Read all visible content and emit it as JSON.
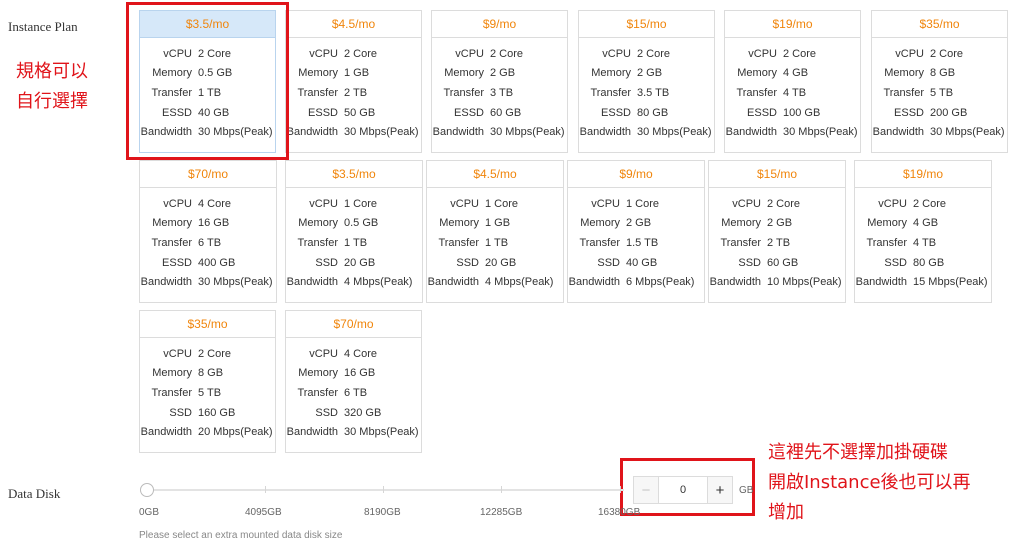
{
  "labels": {
    "instance_plan": "Instance Plan",
    "data_disk": "Data Disk"
  },
  "plans": [
    {
      "price": "$3.5/mo",
      "vcpu": "2 Core",
      "memory": "0.5 GB",
      "transfer": "1 TB",
      "disk_type": "ESSD",
      "disk": "40 GB",
      "bandwidth": "30 Mbps(Peak)",
      "selected": true
    },
    {
      "price": "$4.5/mo",
      "vcpu": "2 Core",
      "memory": "1 GB",
      "transfer": "2 TB",
      "disk_type": "ESSD",
      "disk": "50 GB",
      "bandwidth": "30 Mbps(Peak)"
    },
    {
      "price": "$9/mo",
      "vcpu": "2 Core",
      "memory": "2 GB",
      "transfer": "3 TB",
      "disk_type": "ESSD",
      "disk": "60 GB",
      "bandwidth": "30 Mbps(Peak)"
    },
    {
      "price": "$15/mo",
      "vcpu": "2 Core",
      "memory": "2 GB",
      "transfer": "3.5 TB",
      "disk_type": "ESSD",
      "disk": "80 GB",
      "bandwidth": "30 Mbps(Peak)"
    },
    {
      "price": "$19/mo",
      "vcpu": "2 Core",
      "memory": "4 GB",
      "transfer": "4 TB",
      "disk_type": "ESSD",
      "disk": "100 GB",
      "bandwidth": "30 Mbps(Peak)"
    },
    {
      "price": "$35/mo",
      "vcpu": "2 Core",
      "memory": "8 GB",
      "transfer": "5 TB",
      "disk_type": "ESSD",
      "disk": "200 GB",
      "bandwidth": "30 Mbps(Peak)"
    },
    {
      "price": "$70/mo",
      "vcpu": "4 Core",
      "memory": "16 GB",
      "transfer": "6 TB",
      "disk_type": "ESSD",
      "disk": "400 GB",
      "bandwidth": "30 Mbps(Peak)"
    },
    {
      "price": "$3.5/mo",
      "vcpu": "1 Core",
      "memory": "0.5 GB",
      "transfer": "1 TB",
      "disk_type": "SSD",
      "disk": "20 GB",
      "bandwidth": "4 Mbps(Peak)"
    },
    {
      "price": "$4.5/mo",
      "vcpu": "1 Core",
      "memory": "1 GB",
      "transfer": "1 TB",
      "disk_type": "SSD",
      "disk": "20 GB",
      "bandwidth": "4 Mbps(Peak)"
    },
    {
      "price": "$9/mo",
      "vcpu": "1 Core",
      "memory": "2 GB",
      "transfer": "1.5 TB",
      "disk_type": "SSD",
      "disk": "40 GB",
      "bandwidth": "6 Mbps(Peak)"
    },
    {
      "price": "$15/mo",
      "vcpu": "2 Core",
      "memory": "2 GB",
      "transfer": "2 TB",
      "disk_type": "SSD",
      "disk": "60 GB",
      "bandwidth": "10 Mbps(Peak)"
    },
    {
      "price": "$19/mo",
      "vcpu": "2 Core",
      "memory": "4 GB",
      "transfer": "4 TB",
      "disk_type": "SSD",
      "disk": "80 GB",
      "bandwidth": "15 Mbps(Peak)"
    },
    {
      "price": "$35/mo",
      "vcpu": "2 Core",
      "memory": "8 GB",
      "transfer": "5 TB",
      "disk_type": "SSD",
      "disk": "160 GB",
      "bandwidth": "20 Mbps(Peak)"
    },
    {
      "price": "$70/mo",
      "vcpu": "4 Core",
      "memory": "16 GB",
      "transfer": "6 TB",
      "disk_type": "SSD",
      "disk": "320 GB",
      "bandwidth": "30 Mbps(Peak)"
    }
  ],
  "spec_labels": {
    "vcpu": "vCPU",
    "memory": "Memory",
    "transfer": "Transfer",
    "bandwidth": "Bandwidth"
  },
  "data_disk": {
    "ticks": [
      "0GB",
      "4095GB",
      "8190GB",
      "12285GB",
      "16380GB"
    ],
    "value": "0",
    "unit": "GB",
    "hint": "Please select an extra mounted data disk size",
    "minus": "−",
    "plus": "+"
  },
  "annotations": {
    "left_line1": "規格可以",
    "left_line2": "自行選擇",
    "right_line1": "這裡先不選擇加掛硬碟",
    "right_line2": "開啟Instance後也可以再",
    "right_line3": "增加"
  },
  "colors": {
    "price": "#f0850b",
    "annotation": "#e0141a",
    "selected_header": "#d6e8f9"
  }
}
